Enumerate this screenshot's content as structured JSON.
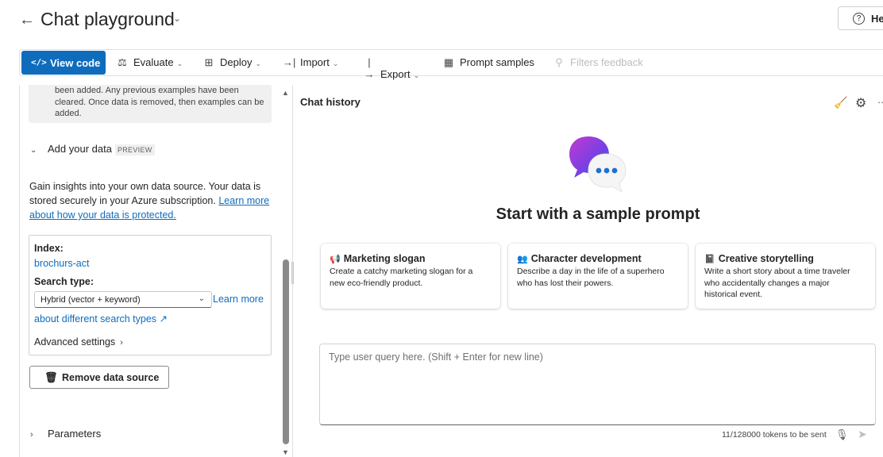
{
  "header": {
    "back_icon": "←",
    "title": "Chat playground",
    "title_chevron": "⌄",
    "help_label": "He"
  },
  "toolbar": {
    "view_code": {
      "icon": "</>",
      "label": "View code"
    },
    "evaluate": {
      "icon": "⚖",
      "label": "Evaluate"
    },
    "deploy": {
      "icon": "⊞",
      "label": "Deploy"
    },
    "import": {
      "icon": "→|",
      "label": "Import"
    },
    "export": {
      "icon": "|→",
      "label": "Export"
    },
    "prompt_samples": {
      "icon": "▦",
      "label": "Prompt samples"
    },
    "filters_feedback": {
      "icon": "⚲",
      "label": "Filters feedback"
    },
    "chevron": "⌄"
  },
  "setup": {
    "note_text": "been added. Any previous examples have been cleared. Once data is removed, then examples can be added.",
    "add_data_label": "Add your data",
    "preview_badge": "PREVIEW",
    "description": "Gain insights into your own data source. Your data is stored securely in your Azure subscription.",
    "description_link": "Learn more about how your data is protected.",
    "index_label": "Index:",
    "index_value": "brochurs-act",
    "search_type_label": "Search type:",
    "search_type_value": "Hybrid (vector + keyword)",
    "learn_more_1": "Learn more",
    "learn_more_2": "about different search types",
    "external_icon": "↗",
    "advanced_settings": "Advanced settings",
    "remove_data_source": "Remove data source",
    "parameters": "Parameters"
  },
  "chat": {
    "history_title": "Chat history",
    "start_title": "Start with a sample prompt",
    "samples": [
      {
        "icon": "📢",
        "title": "Marketing slogan",
        "description": "Create a catchy marketing slogan for a new eco-friendly product."
      },
      {
        "icon": "👥",
        "title": "Character development",
        "description": "Describe a day in the life of a superhero who has lost their powers."
      },
      {
        "icon": "📓",
        "title": "Creative storytelling",
        "description": "Write a short story about a time traveler who accidentally changes a major historical event."
      }
    ],
    "query_placeholder": "Type user query here. (Shift + Enter for new line)",
    "token_count": "11/128000 tokens to be sent"
  },
  "colors": {
    "accent": "#0f6cbd",
    "logo_purple": "#7b3fe4",
    "logo_pink": "#c23bcf",
    "logo_blue": "#1f6fd9"
  }
}
